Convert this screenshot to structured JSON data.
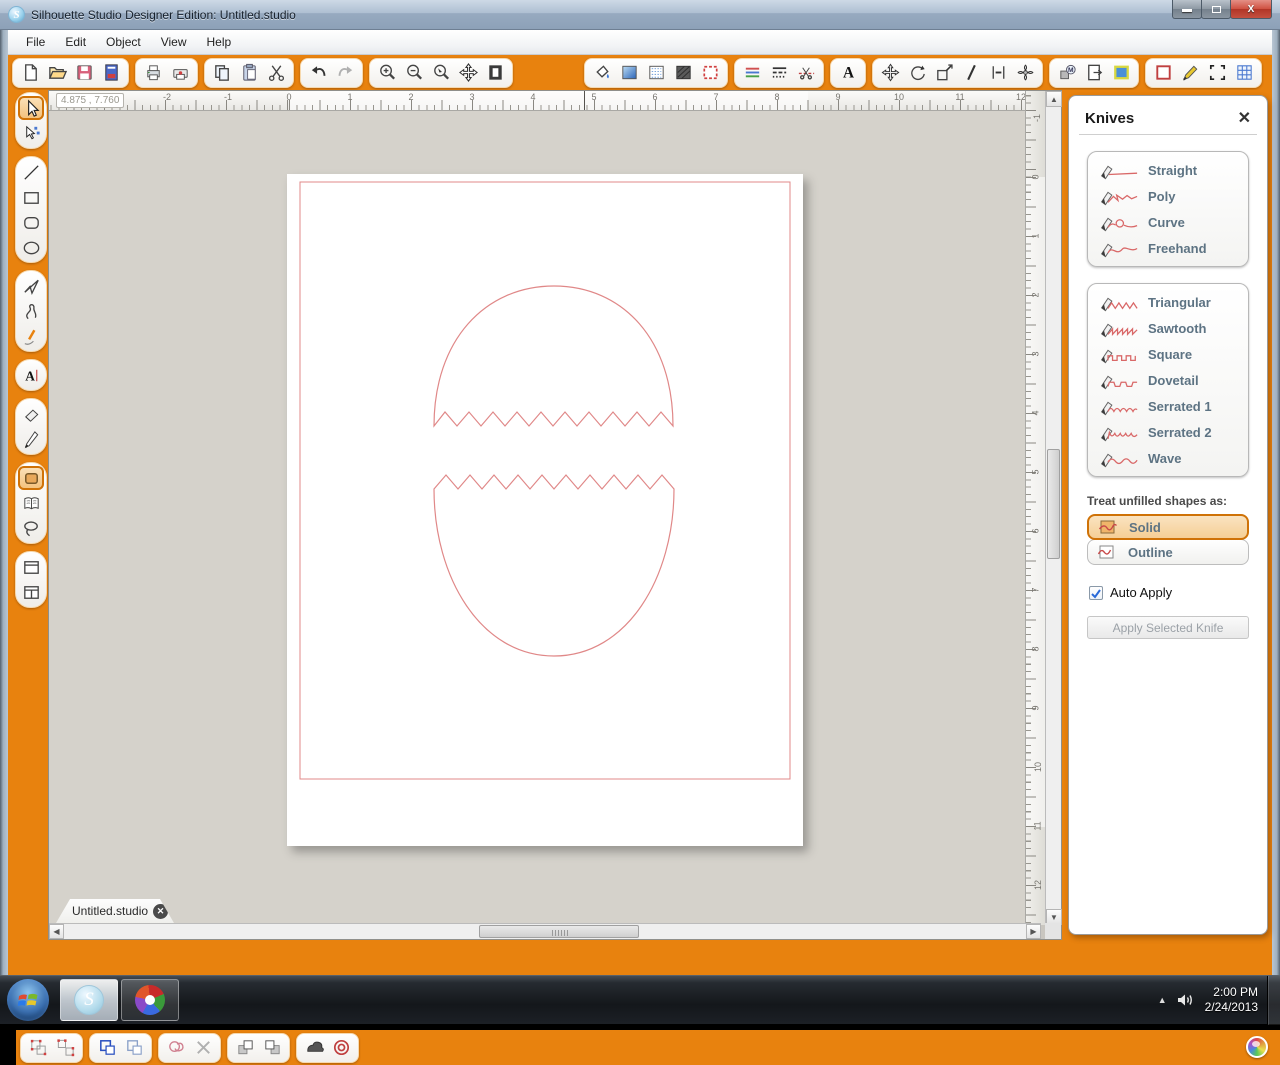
{
  "window": {
    "title": "Silhouette Studio Designer Edition: Untitled.studio"
  },
  "menu": {
    "items": [
      "File",
      "Edit",
      "Object",
      "View",
      "Help"
    ]
  },
  "toolbar": {
    "left_groups": [
      [
        "new-document",
        "open-file",
        "save",
        "save-to-library"
      ],
      [
        "print",
        "send-to-silhouette"
      ],
      [
        "copy",
        "paste",
        "cut"
      ],
      [
        "undo",
        "redo"
      ],
      [
        "zoom-in",
        "zoom-out",
        "zoom-selection",
        "pan",
        "fit-to-page"
      ]
    ],
    "right_groups": [
      [
        "fill-color",
        "fill-gradient",
        "fill-pattern",
        "shadow",
        "line-style-window"
      ],
      [
        "line-color",
        "line-styles",
        "cut-style"
      ],
      [
        "text-style"
      ],
      [
        "transform",
        "rotate",
        "scale",
        "shear",
        "align",
        "replicate"
      ],
      [
        "modify",
        "page-panel",
        "trace"
      ],
      [
        "registration-marks",
        "sketch-pens",
        "cut-settings",
        "grid-settings"
      ]
    ]
  },
  "sidebar": {
    "groups": [
      [
        {
          "icon": "select-arrow",
          "active": true
        },
        {
          "icon": "edit-points"
        }
      ],
      [
        {
          "icon": "line-tool"
        },
        {
          "icon": "rectangle-tool"
        },
        {
          "icon": "rounded-rectangle-tool"
        },
        {
          "icon": "ellipse-tool"
        }
      ],
      [
        {
          "icon": "polygon-tool"
        },
        {
          "icon": "curve-tool"
        },
        {
          "icon": "freehand-tool"
        }
      ],
      [
        {
          "icon": "text-tool"
        }
      ],
      [
        {
          "icon": "eraser-tool"
        },
        {
          "icon": "knife-tool"
        }
      ],
      [
        {
          "icon": "shape-tool",
          "active": true
        },
        {
          "icon": "library-tool"
        },
        {
          "icon": "lasso-tool"
        }
      ],
      [
        {
          "icon": "layout-single"
        },
        {
          "icon": "layout-split"
        }
      ]
    ]
  },
  "rulers": {
    "cursor_position": "4.875 , 7.760",
    "horizontal_labels": [
      "-2",
      "-1",
      "0",
      "1",
      "2",
      "3",
      "4",
      "5",
      "6",
      "7",
      "8",
      "9",
      "10",
      "11",
      "12"
    ],
    "vertical_labels": [
      "-1",
      "0",
      "1",
      "2",
      "3",
      "4",
      "5",
      "6",
      "7",
      "8",
      "9",
      "10",
      "11",
      "12"
    ]
  },
  "canvas": {
    "shapes": [
      "egg-top-half",
      "egg-bottom-half"
    ]
  },
  "knives_panel": {
    "title": "Knives",
    "basic_knives": [
      {
        "icon": "straight",
        "label": "Straight"
      },
      {
        "icon": "poly",
        "label": "Poly"
      },
      {
        "icon": "curve",
        "label": "Curve"
      },
      {
        "icon": "freehand",
        "label": "Freehand"
      }
    ],
    "pattern_knives": [
      {
        "icon": "triangular",
        "label": "Triangular"
      },
      {
        "icon": "sawtooth",
        "label": "Sawtooth"
      },
      {
        "icon": "square",
        "label": "Square"
      },
      {
        "icon": "dovetail",
        "label": "Dovetail"
      },
      {
        "icon": "serrated1",
        "label": "Serrated 1"
      },
      {
        "icon": "serrated2",
        "label": "Serrated 2"
      },
      {
        "icon": "wave",
        "label": "Wave"
      }
    ],
    "treat_label": "Treat unfilled shapes as:",
    "solid_label": "Solid",
    "outline_label": "Outline",
    "selected_mode": "Solid",
    "auto_apply_label": "Auto Apply",
    "auto_apply_checked": true,
    "apply_button_label": "Apply Selected Knife"
  },
  "document_tab": {
    "label": "Untitled.studio"
  },
  "bottom_toolbar": {
    "groups": [
      [
        "group-objects",
        "ungroup-objects"
      ],
      [
        "make-compound-path",
        "release-compound-path"
      ],
      [
        "weld-shapes",
        "delete-shape"
      ],
      [
        "bring-forward",
        "send-backward"
      ],
      [
        "weld-solid",
        "bullseye"
      ]
    ]
  },
  "taskbar": {
    "time": "2:00 PM",
    "date": "2/24/2013"
  },
  "colors": {
    "accent_orange": "#E8820E",
    "cut_line": "#E08888",
    "knife_pattern_red": "#D96868",
    "selected_tan": "#F5CF96",
    "canvas_gray": "#D5D2CB",
    "label_blue_gray": "#5D7383"
  }
}
